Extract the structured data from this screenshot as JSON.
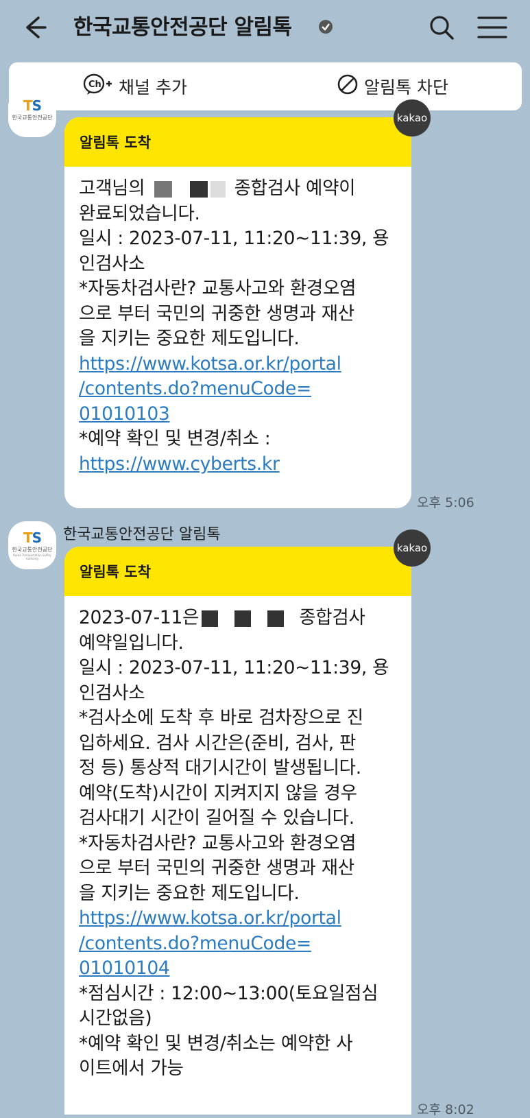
{
  "header": {
    "title": "한국교통안전공단 알림톡",
    "verified_icon": "verified-badge-icon",
    "back_icon": "back-arrow-icon",
    "search_icon": "search-icon",
    "menu_icon": "hamburger-menu-icon"
  },
  "actions": {
    "add_channel": "채널 추가",
    "add_channel_icon": "channel-add-icon",
    "block": "알림톡 차단",
    "block_icon": "block-icon"
  },
  "avatar": {
    "logo": "TS",
    "org_name": "한국교통안전공단",
    "org_name_en": "Korea Transportation Safety Authority"
  },
  "messages": [
    {
      "header": "알림톡 도착",
      "badge": "kakao",
      "time": "오후 5:06",
      "lines": {
        "l1_pre": "고객님의",
        "l1_post": "종합검사 예약이",
        "l2": "완료되었습니다.",
        "l3": "일시 : 2023-07-11, 11:20~11:39, 용",
        "l4": "인검사소",
        "l5": "*자동차검사란? 교통사고와 환경오염",
        "l6": "으로 부터 국민의 귀중한 생명과 재산",
        "l7": "을 지키는 중요한 제도입니다.",
        "link1a": "https://www.kotsa.or.kr/portal",
        "link1b": "/contents.do?menuCode=",
        "link1c": "01010103",
        "l8": "*예약 확인 및 변경/취소 :",
        "link2": "https://www.cyberts.kr"
      }
    },
    {
      "sender": "한국교통안전공단 알림톡",
      "header": "알림톡 도착",
      "badge": "kakao",
      "time": "오후 8:02",
      "lines": {
        "l1_pre": "2023-07-11은",
        "l1_post": "종합검사",
        "l2": "예약일입니다.",
        "l3": "일시 : 2023-07-11, 11:20~11:39, 용",
        "l4": "인검사소",
        "l5": "*검사소에 도착 후 바로 검차장으로 진",
        "l6": "입하세요. 검사 시간은(준비, 검사, 판",
        "l7": "정 등) 통상적 대기시간이 발생됩니다.",
        "l8": "예약(도착)시간이 지켜지지 않을 경우",
        "l9": "검사대기 시간이 길어질 수 있습니다.",
        "l10": "*자동차검사란? 교통사고와 환경오염",
        "l11": "으로 부터 국민의 귀중한 생명과 재산",
        "l12": "을 지키는 중요한 제도입니다.",
        "link1a": "https://www.kotsa.or.kr/portal",
        "link1b": "/contents.do?menuCode=",
        "link1c": "01010104",
        "l13": "*점심시간 : 12:00~13:00(토요일점심",
        "l14": "시간없음)",
        "l15": "*예약 확인 및 변경/취소는 예약한 사",
        "l16": "이트에서 가능"
      }
    }
  ]
}
